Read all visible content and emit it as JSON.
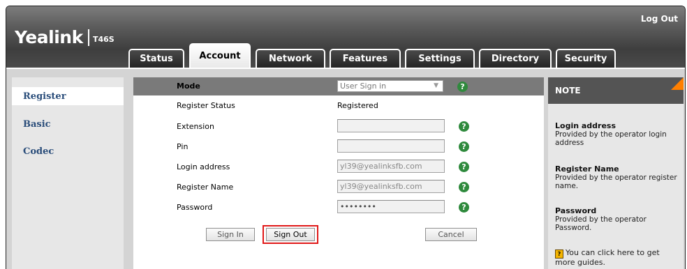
{
  "header": {
    "brand": "Yealink",
    "model": "T46S",
    "logout": "Log Out"
  },
  "tabs": [
    {
      "label": "Status"
    },
    {
      "label": "Account"
    },
    {
      "label": "Network"
    },
    {
      "label": "Features"
    },
    {
      "label": "Settings"
    },
    {
      "label": "Directory"
    },
    {
      "label": "Security"
    }
  ],
  "sidebar": {
    "items": [
      {
        "label": "Register"
      },
      {
        "label": "Basic"
      },
      {
        "label": "Codec"
      }
    ]
  },
  "form": {
    "mode_label": "Mode",
    "mode_value": "User Sign in",
    "register_status_label": "Register Status",
    "register_status_value": "Registered",
    "extension_label": "Extension",
    "extension_value": "",
    "pin_label": "Pin",
    "pin_value": "",
    "login_address_label": "Login address",
    "login_address_value": "yl39@yealinksfb.com",
    "register_name_label": "Register Name",
    "register_name_value": "yl39@yealinksfb.com",
    "password_label": "Password",
    "password_value": "••••••••",
    "help_glyph": "?",
    "sign_in": "Sign In",
    "sign_out": "Sign Out",
    "cancel": "Cancel"
  },
  "note": {
    "title": "NOTE",
    "sections": [
      {
        "title": "Login address",
        "text": "Provided by the operator login address"
      },
      {
        "title": "Register Name",
        "text": "Provided by the operator register name."
      },
      {
        "title": "Password",
        "text": "Provided by the operator Password."
      }
    ],
    "guide_text": "You can click here to get more guides."
  },
  "colors": {
    "header": "#4a4a4a",
    "help": "#2f8a3d",
    "note_corner": "#ff7f00",
    "highlight": "#e01818",
    "sidebar_text": "#2a4d7a"
  }
}
